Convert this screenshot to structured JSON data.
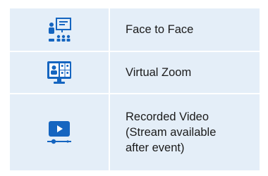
{
  "colors": {
    "brand_blue": "#1565c0",
    "row_bg": "#e4eef8",
    "text": "#1b1b1b"
  },
  "rows": [
    {
      "icon": "classroom-presentation-icon",
      "label_lines": [
        "Face to Face"
      ]
    },
    {
      "icon": "video-conference-icon",
      "label_lines": [
        "Virtual Zoom"
      ]
    },
    {
      "icon": "video-player-icon",
      "label_lines": [
        "Recorded Video",
        "(Stream available",
        "after event)"
      ]
    }
  ]
}
